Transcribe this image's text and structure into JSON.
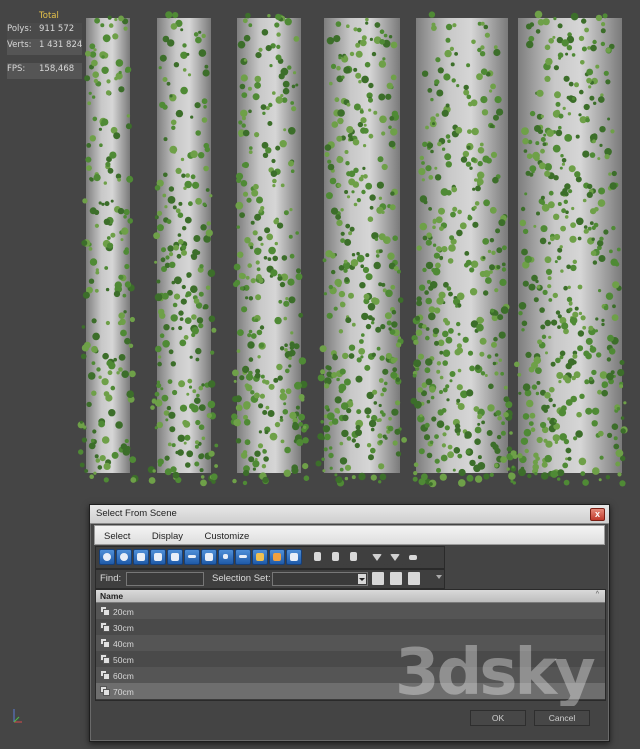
{
  "viewport": {
    "stats": {
      "header": "Total",
      "polys_label": "Polys:",
      "polys_value": "911 572",
      "verts_label": "Verts:",
      "verts_value": "1 431 824",
      "fps_label": "FPS:",
      "fps_value": "158,468"
    }
  },
  "dialog": {
    "title": "Select From Scene",
    "close_glyph": "x",
    "menu": [
      "Select",
      "Display",
      "Customize"
    ],
    "find_label": "Find:",
    "find_value": "",
    "selection_set_label": "Selection Set:",
    "selection_set_value": "",
    "column_header": "Name",
    "sort_indicator": "^",
    "items": [
      {
        "label": "20cm",
        "selected": false
      },
      {
        "label": "30cm",
        "selected": false
      },
      {
        "label": "40cm",
        "selected": false
      },
      {
        "label": "50cm",
        "selected": false
      },
      {
        "label": "60cm",
        "selected": false
      },
      {
        "label": "70cm",
        "selected": true
      }
    ],
    "ok_label": "OK",
    "cancel_label": "Cancel"
  },
  "watermark": "3dsky",
  "colors": {
    "viewport_bg": "#454545",
    "stats_text": "#e6c24a",
    "ivy_green": "#4f8a35",
    "column_concrete": "#c8c8c8",
    "toolbar_icon_blue": "#2f6fc0"
  }
}
